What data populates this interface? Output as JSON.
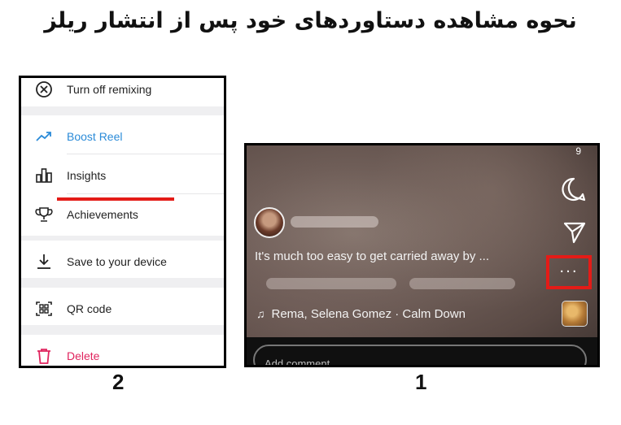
{
  "page": {
    "title": "نحوه مشاهده دستاوردهای خود پس از انتشار ریلز"
  },
  "panel2": {
    "number": "2",
    "menu": [
      {
        "label": "Turn off remixing",
        "icon": "close-circle-icon",
        "color": "#222222"
      },
      {
        "label": "Boost Reel",
        "icon": "trending-up-icon",
        "color": "#2b8bd8"
      },
      {
        "label": "Insights",
        "icon": "bar-chart-icon",
        "color": "#222222"
      },
      {
        "label": "Achievements",
        "icon": "trophy-icon",
        "color": "#222222"
      },
      {
        "label": "Save to your device",
        "icon": "download-icon",
        "color": "#222222"
      },
      {
        "label": "QR code",
        "icon": "qr-code-icon",
        "color": "#222222"
      },
      {
        "label": "Delete",
        "icon": "trash-icon",
        "color": "#e0245e"
      }
    ],
    "highlight_color": "#e41b17"
  },
  "panel1": {
    "number": "1",
    "counter": "9",
    "caption": "It's much too easy to get carried away by ...",
    "music": "Rema, Selena Gomez · Calm Down",
    "more_label": "···",
    "comment_placeholder": "Add comment"
  }
}
